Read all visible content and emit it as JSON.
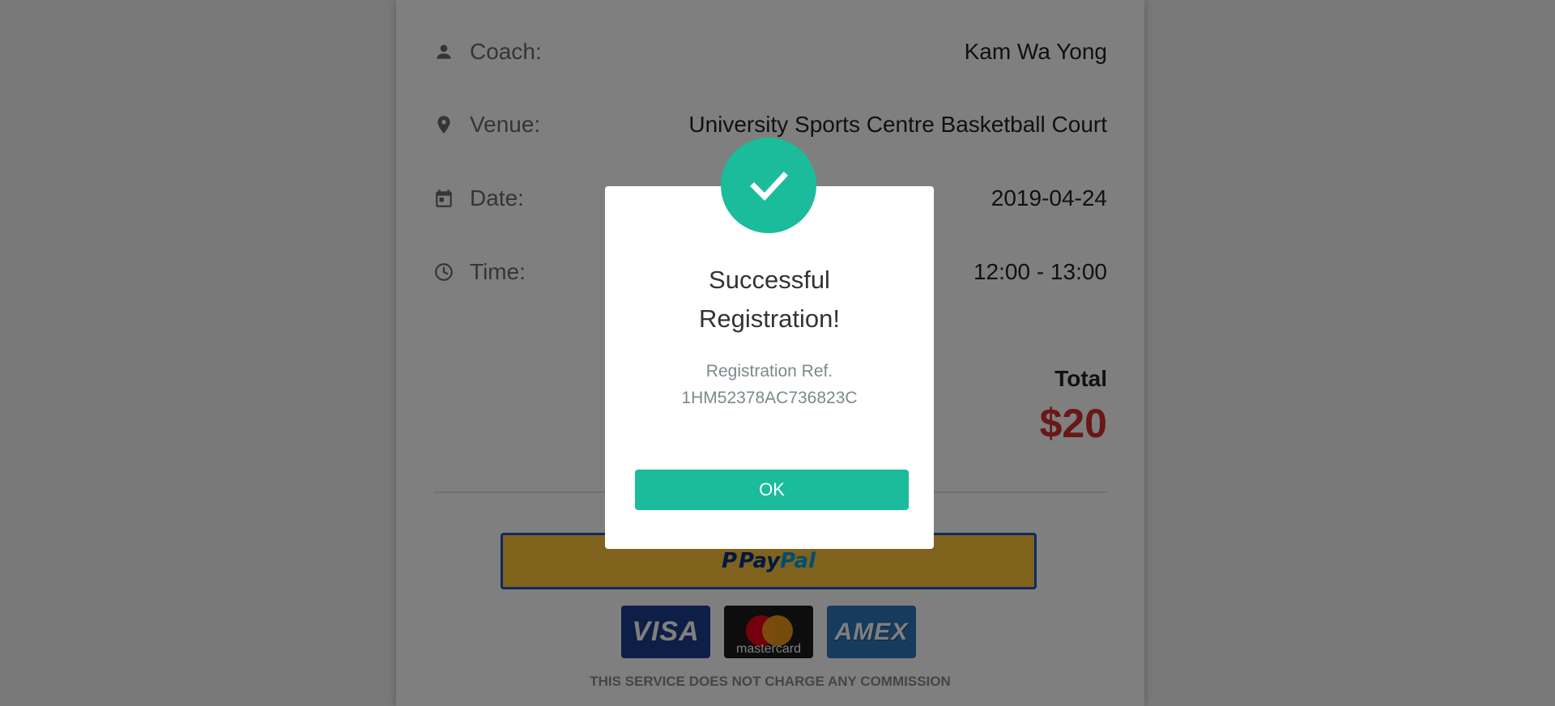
{
  "details": {
    "coach_label": "Coach:",
    "coach_value": "Kam Wa Yong",
    "venue_label": "Venue:",
    "venue_value": "University Sports Centre Basketball Court",
    "date_label": "Date:",
    "date_value": "2019-04-24",
    "time_label": "Time:",
    "time_value": "12:00 - 13:00"
  },
  "total": {
    "label": "Total",
    "amount": "$20"
  },
  "payment": {
    "paypal_mark": "P",
    "paypal_pay": "Pay",
    "paypal_pal": "Pal",
    "cards": {
      "visa": "VISA",
      "mastercard": "mastercard",
      "amex": "AMEX"
    },
    "notice": "THIS SERVICE DOES NOT CHARGE ANY COMMISSION"
  },
  "modal": {
    "title": "Successful Registration!",
    "ref_label": "Registration Ref.",
    "ref_value": "1HM52378AC736823C",
    "ok_label": "OK"
  },
  "colors": {
    "accent": "#1abc9c",
    "total_amount": "#d32f2f",
    "paypal_yellow": "#ffc439",
    "paypal_border": "#1d55c0",
    "overlay": "rgba(0,0,0,0.5)"
  },
  "icons": {
    "coach": "person-icon",
    "venue": "location-pin-icon",
    "date": "calendar-icon",
    "time": "clock-icon",
    "success": "checkmark-icon"
  }
}
